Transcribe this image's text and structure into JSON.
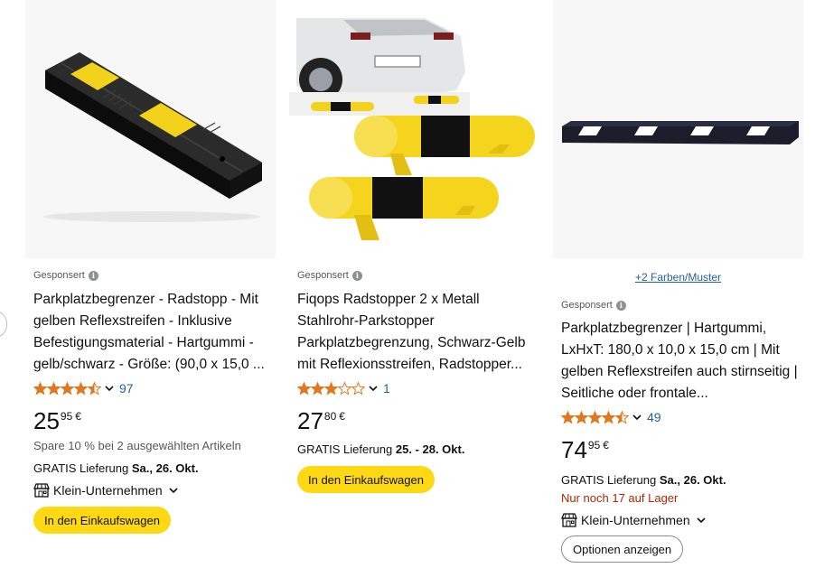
{
  "colors": {
    "link": "#2162a1",
    "star": "#de7921",
    "cart_button": "#ffd814",
    "stock_warning": "#b12704"
  },
  "products": [
    {
      "sponsored": "Gesponsert",
      "title": "Parkplatzbegrenzer - Radstopp - Mit gelben Reflexstreifen - Inklusive Befestigungsmaterial - Hartgummi - gelb/schwarz - Größe: (90,0 x 15,0 ...",
      "rating": 4.5,
      "reviews": "97",
      "price_whole": "25",
      "price_fraction": "95",
      "currency": "€",
      "promo": "Spare 10 % bei 2 ausgewählten Artikeln",
      "delivery_prefix": "GRATIS Lieferung ",
      "delivery_date": "Sa., 26. Okt.",
      "badge": "Klein-Unternehmen",
      "button": "In den Einkaufswagen",
      "image": "black-yellow-rubber-wheel-stop"
    },
    {
      "sponsored": "Gesponsert",
      "title": "Fiqops Radstopper 2 x Metall Stahlrohr-Parkstopper Parkplatzbegrenzung, Schwarz-Gelb mit Reflexionsstreifen, Radstopper...",
      "rating": 3,
      "reviews": "1",
      "price_whole": "27",
      "price_fraction": "80",
      "currency": "€",
      "delivery_prefix": "GRATIS Lieferung ",
      "delivery_date": "25. - 28. Okt.",
      "button": "In den Einkaufswagen",
      "image": "yellow-steel-tube-parking-stoppers-with-car"
    },
    {
      "color_options": "+2 Farben/Muster",
      "sponsored": "Gesponsert",
      "title": "Parkplatzbegrenzer | Hartgummi, LxHxT: 180,0 x 10,0 x 15,0 cm | Mit gelben Reflexstreifen auch stirnseitig | Seitliche oder frontale...",
      "rating": 4.5,
      "reviews": "49",
      "price_whole": "74",
      "price_fraction": "95",
      "currency": "€",
      "delivery_prefix": "GRATIS Lieferung ",
      "delivery_date": "Sa., 26. Okt.",
      "stock": "Nur noch 17 auf Lager",
      "badge": "Klein-Unternehmen",
      "button": "Optionen anzeigen",
      "image": "long-black-wheel-stop-white-reflectors"
    }
  ]
}
